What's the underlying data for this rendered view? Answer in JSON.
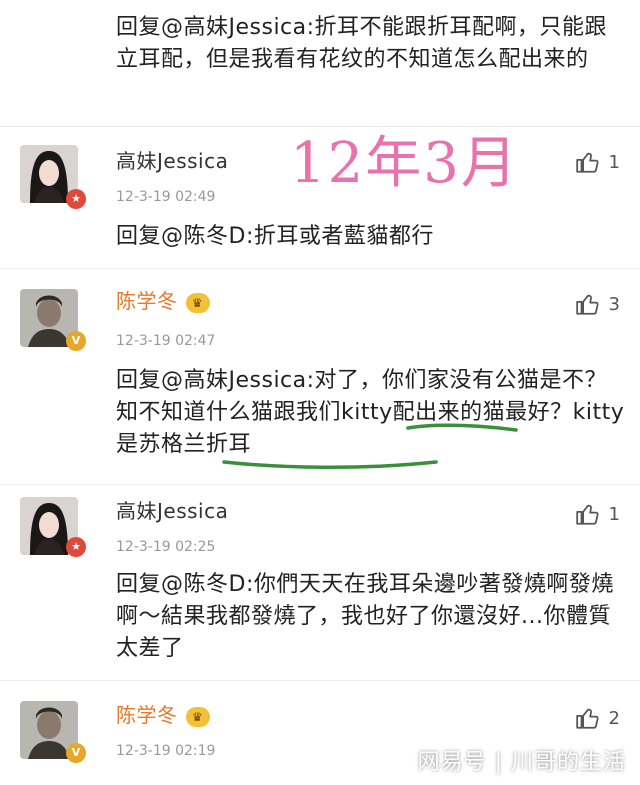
{
  "colors": {
    "orange_name": "#e8782a",
    "pink_annotation": "#e86aa8",
    "green_underline": "#3a8f3a",
    "badge_red": "#e0483b",
    "badge_gold": "#e8a72b"
  },
  "top_reply": {
    "text": "回复@高妹Jessica:折耳不能跟折耳配啊，只能跟立耳配，但是我看有花纹的不知道怎么配出来的"
  },
  "annotation": {
    "text": "12年3月"
  },
  "comments": [
    {
      "username": "高妹Jessica",
      "timestamp": "12-3-19 02:49",
      "likes": "1",
      "reply": "回复@陈冬D:折耳或者藍貓都行",
      "badge": "red",
      "avatar": "woman-avatar"
    },
    {
      "username": "陈学冬",
      "timestamp": "12-3-19 02:47",
      "likes": "3",
      "reply": "回复@高妹Jessica:对了，你们家没有公猫是不？知不知道什么猫跟我们kitty配出来的猫最好？kitty是苏格兰折耳",
      "badge": "gold",
      "avatar": "man-avatar"
    },
    {
      "username": "高妹Jessica",
      "timestamp": "12-3-19 02:25",
      "likes": "1",
      "reply": "回复@陈冬D:你們天天在我耳朵邊吵著發燒啊發燒啊～結果我都發燒了，我也好了你還沒好...你體質太差了",
      "badge": "red",
      "avatar": "woman-avatar"
    },
    {
      "username": "陈学冬",
      "timestamp": "12-3-19 02:19",
      "likes": "2",
      "reply": "",
      "badge": "gold",
      "avatar": "man-avatar"
    }
  ],
  "level_icon": "level-badge-icon",
  "like_icon": "thumbs-up-icon",
  "watermark": "网易号 | 川哥的生活"
}
